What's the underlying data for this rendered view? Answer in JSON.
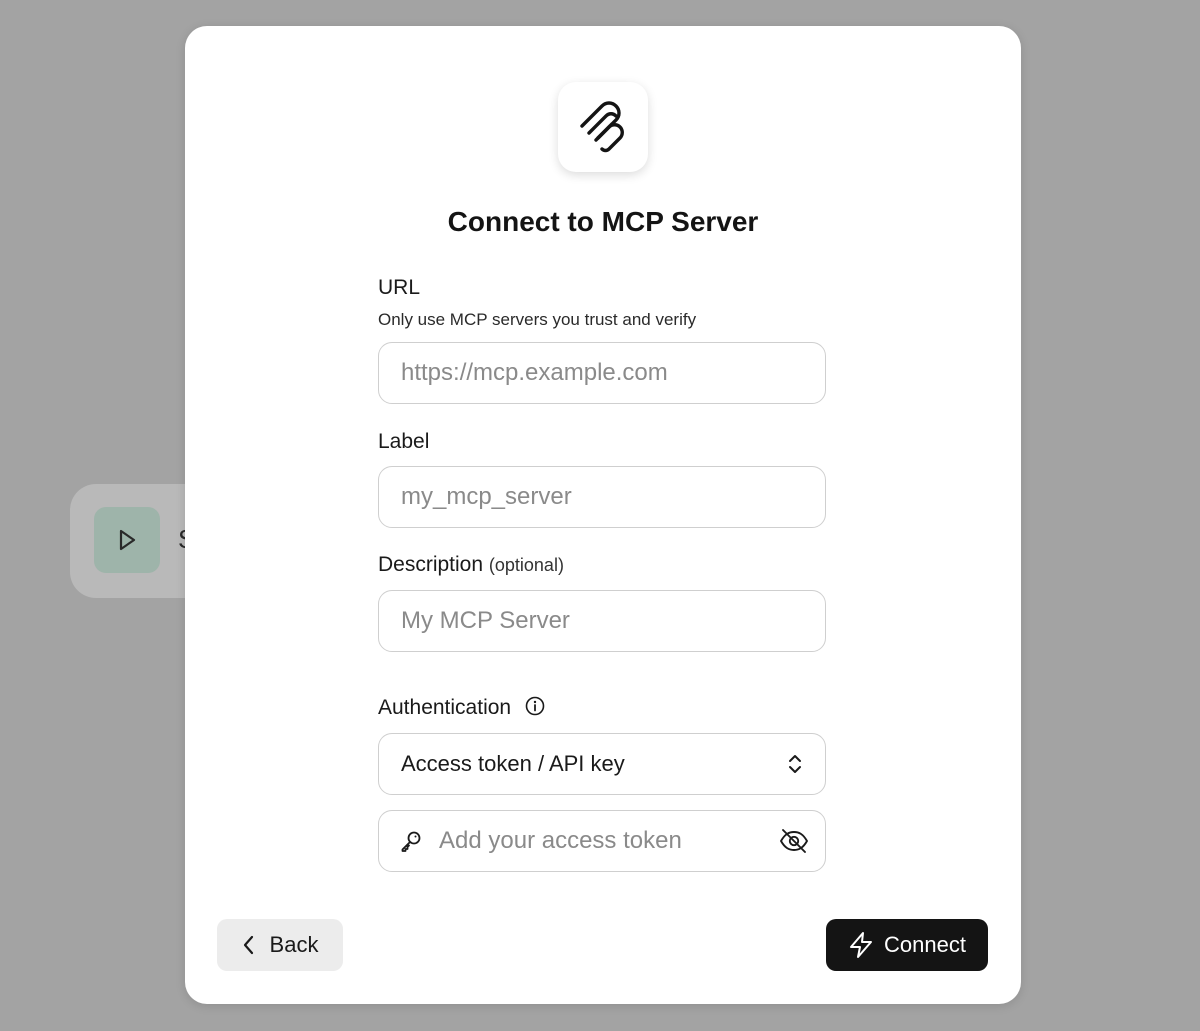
{
  "background": {
    "partial_letter": "S"
  },
  "dialog": {
    "title": "Connect to MCP Server",
    "fields": {
      "url": {
        "label": "URL",
        "hint": "Only use MCP servers you trust and verify",
        "value": "",
        "placeholder": "https://mcp.example.com"
      },
      "label": {
        "label": "Label",
        "value": "",
        "placeholder": "my_mcp_server"
      },
      "description": {
        "label": "Description",
        "optional_tag": "(optional)",
        "value": "",
        "placeholder": "My MCP Server"
      },
      "authentication": {
        "label": "Authentication",
        "selected": "Access token / API key"
      },
      "token": {
        "value": "",
        "placeholder": "Add your access token"
      }
    },
    "buttons": {
      "back": "Back",
      "connect": "Connect"
    }
  },
  "colors": {
    "backdrop": "#a3a3a3",
    "primary_button": "#141414",
    "secondary_button": "#ececec",
    "play_tile": "#9eb4aa"
  },
  "icons": {
    "logo": "mcp-logo-icon",
    "play": "play-icon",
    "info": "info-icon",
    "select": "chevron-up-down-icon",
    "key": "key-icon",
    "visibility": "eye-off-icon",
    "back": "chevron-left-icon",
    "connect": "lightning-icon"
  }
}
